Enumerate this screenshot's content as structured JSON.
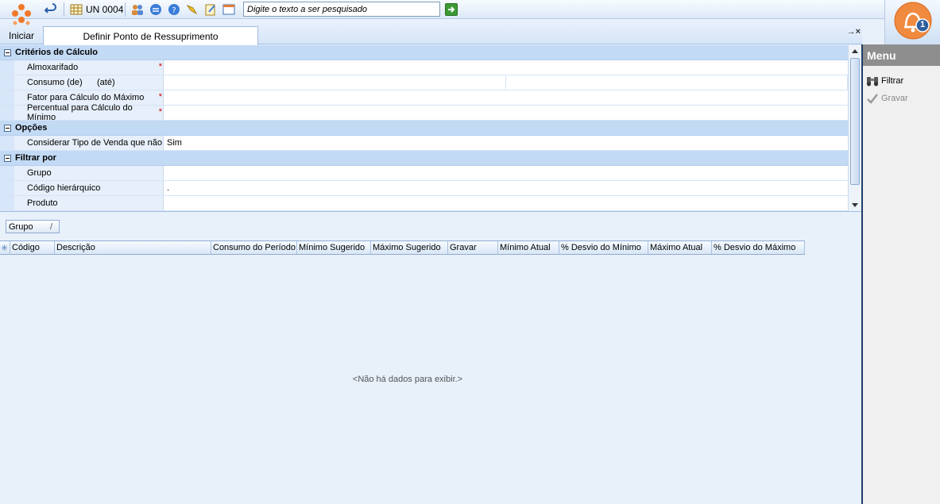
{
  "toolbar": {
    "start_label": "Iniciar",
    "unit_label": "UN 0004",
    "search_placeholder": "Digite o texto a ser pesquisado"
  },
  "notification": {
    "count": "1"
  },
  "tabs": [
    {
      "label": "Definir Ponto de Ressuprimento"
    }
  ],
  "property_grid": {
    "categories": [
      {
        "title": "Critérios de Cálculo",
        "rows": [
          {
            "label": "Almoxarifado",
            "value": ""
          },
          {
            "label": "Consumo (de)",
            "sub_label": "(até)",
            "value": ""
          },
          {
            "label": "Fator para Cálculo do Máximo",
            "value": ""
          },
          {
            "label": "Percentual para Cálculo do Mínimo",
            "value": ""
          }
        ]
      },
      {
        "title": "Opções",
        "rows": [
          {
            "label": "Considerar Tipo de Venda que não",
            "value": "Sim"
          }
        ]
      },
      {
        "title": "Filtrar por",
        "rows": [
          {
            "label": "Grupo",
            "value": ""
          },
          {
            "label": "Código hierárquico",
            "value": "."
          },
          {
            "label": "Produto",
            "value": ""
          }
        ]
      }
    ],
    "required_marker": "*"
  },
  "group_panel": {
    "chip_label": "Grupo",
    "sort_glyph": "/"
  },
  "grid": {
    "columns": [
      "Código",
      "Descrição",
      "Consumo do Período",
      "Mínimo Sugerido",
      "Máximo Sugerido",
      "Gravar",
      "Mínimo Atual",
      "% Desvio do Mínimo",
      "Máximo Atual",
      "% Desvio do Máximo"
    ],
    "empty_message": "<Não há dados para exibir.>"
  },
  "menu": {
    "title": "Menu",
    "items": [
      {
        "label": "Filtrar",
        "enabled": true
      },
      {
        "label": "Gravar",
        "enabled": false
      }
    ]
  }
}
